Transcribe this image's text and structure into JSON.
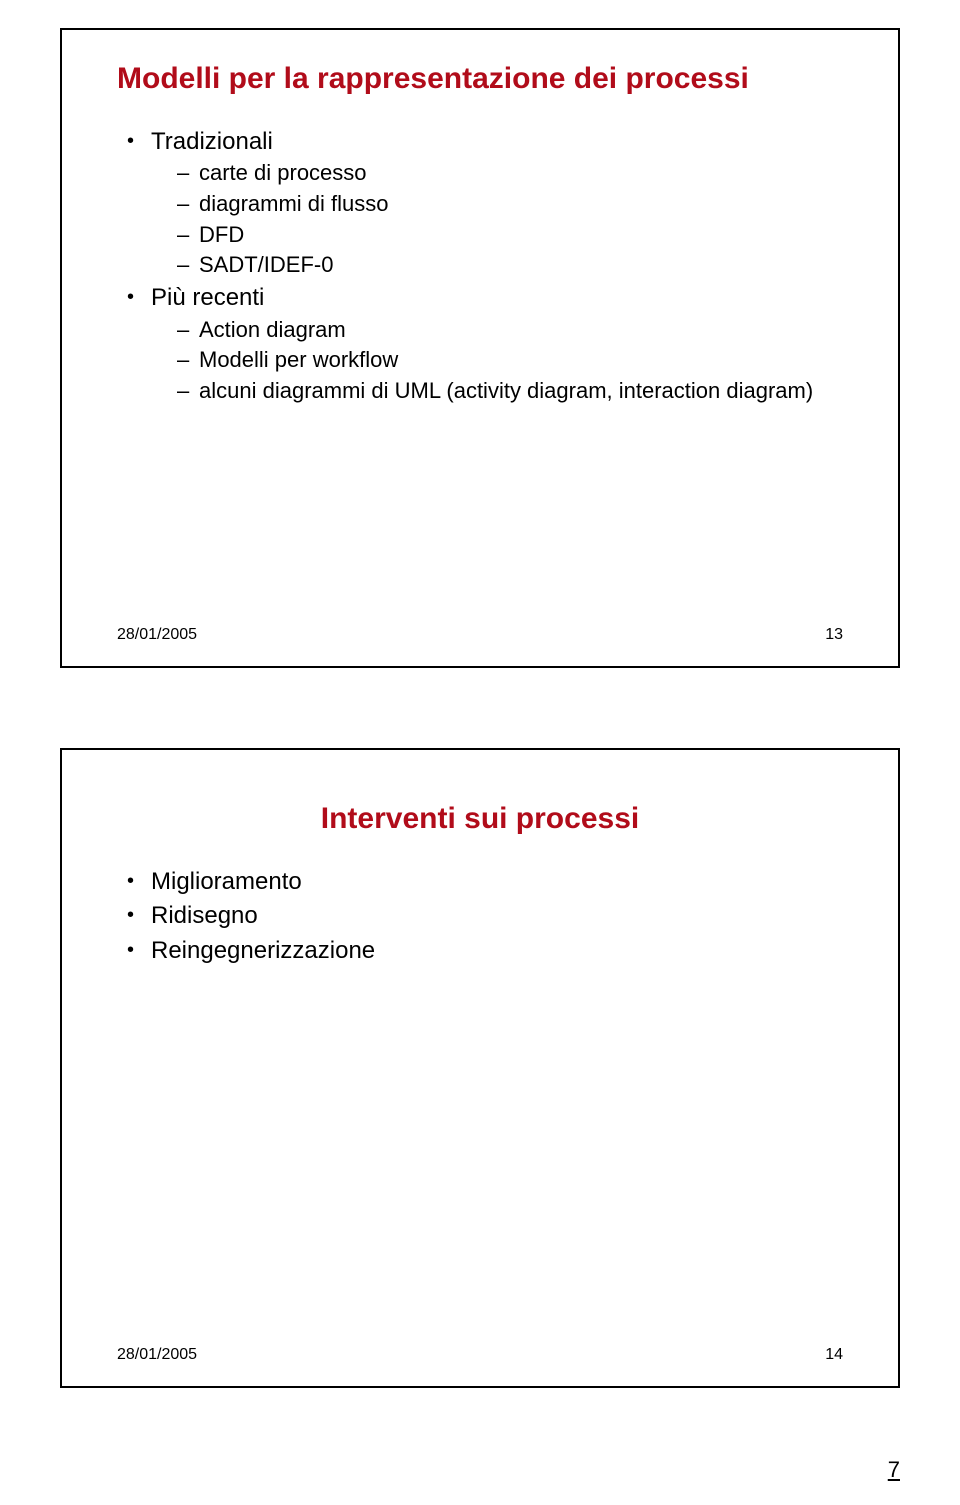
{
  "slide1": {
    "title": "Modelli per la rappresentazione dei processi",
    "items": [
      {
        "label": "Tradizionali",
        "sub": [
          "carte di processo",
          "diagrammi di flusso",
          "DFD",
          "SADT/IDEF-0"
        ]
      },
      {
        "label": "Più recenti",
        "sub": [
          "Action diagram",
          "Modelli per workflow",
          "alcuni diagrammi di UML (activity diagram, interaction diagram)"
        ]
      }
    ],
    "date": "28/01/2005",
    "pageno": "13"
  },
  "slide2": {
    "title": "Interventi sui processi",
    "items": [
      "Miglioramento",
      "Ridisegno",
      "Reingegnerizzazione"
    ],
    "date": "28/01/2005",
    "pageno": "14"
  },
  "sheet_page": "7"
}
